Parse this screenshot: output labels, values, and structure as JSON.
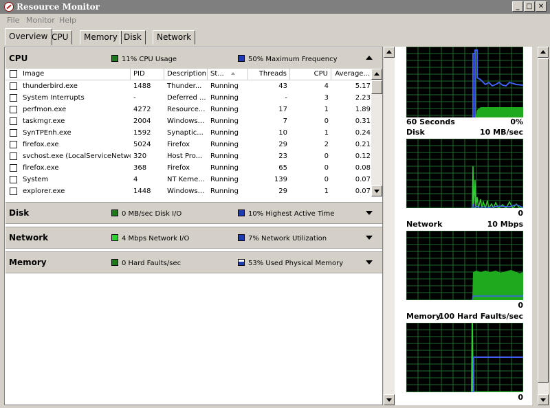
{
  "window": {
    "title": "Resource Monitor",
    "controls": [
      "_",
      "□",
      "✕"
    ]
  },
  "menu": [
    "File",
    "Monitor",
    "Help"
  ],
  "tabs": [
    "Overview",
    "CPU",
    "Memory",
    "Disk",
    "Network"
  ],
  "active_tab": "Overview",
  "cpu": {
    "name": "CPU",
    "usage": "11% CPU Usage",
    "usage_color": "#1a7a1a",
    "frequency": "50% Maximum Frequency",
    "frequency_color": "#1e3bb0",
    "columns": [
      "Image",
      "PID",
      "Description",
      "St...",
      "Threads",
      "CPU",
      "Average..."
    ],
    "rows": [
      [
        "thunderbird.exe",
        "1488",
        "Thunder...",
        "Running",
        "43",
        "4",
        "5.17"
      ],
      [
        "System Interrupts",
        "-",
        "Deferred ...",
        "Running",
        "-",
        "3",
        "2.23"
      ],
      [
        "perfmon.exe",
        "4272",
        "Resource...",
        "Running",
        "17",
        "1",
        "1.89"
      ],
      [
        "taskmgr.exe",
        "2004",
        "Windows...",
        "Running",
        "7",
        "0",
        "0.31"
      ],
      [
        "SynTPEnh.exe",
        "1592",
        "Synaptic...",
        "Running",
        "10",
        "1",
        "0.24"
      ],
      [
        "firefox.exe",
        "5024",
        "Firefox",
        "Running",
        "29",
        "2",
        "0.21"
      ],
      [
        "svchost.exe (LocalServiceNetwo...",
        "320",
        "Host Pro...",
        "Running",
        "23",
        "0",
        "0.12"
      ],
      [
        "firefox.exe",
        "368",
        "Firefox",
        "Running",
        "65",
        "0",
        "0.08"
      ],
      [
        "System",
        "4",
        "NT Kerne...",
        "Running",
        "139",
        "0",
        "0.07"
      ],
      [
        "explorer.exe",
        "1448",
        "Windows...",
        "Running",
        "29",
        "1",
        "0.07"
      ]
    ]
  },
  "disk": {
    "name": "Disk",
    "io": "0 MB/sec Disk I/O",
    "active": "10% Highest Active Time"
  },
  "network": {
    "name": "Network",
    "io": "4 Mbps Network I/O",
    "util": "7% Network Utilization"
  },
  "memory": {
    "name": "Memory",
    "faults": "0 Hard Faults/sec",
    "used": "53% Used Physical Memory"
  },
  "graphs": {
    "cpu": {
      "left": "60 Seconds",
      "right": "0%"
    },
    "disk": {
      "left": "Disk",
      "right": "10 MB/sec",
      "zero": "0"
    },
    "network": {
      "left": "Network",
      "right": "10 Mbps",
      "zero": "0"
    },
    "memory": {
      "left": "Memory",
      "right": "100 Hard Faults/sec",
      "zero": "0"
    }
  },
  "colors": {
    "green": "#1a7a1a",
    "light_green": "#2fd12f",
    "blue": "#1e3bb0",
    "grid": "#1f6d2a"
  }
}
